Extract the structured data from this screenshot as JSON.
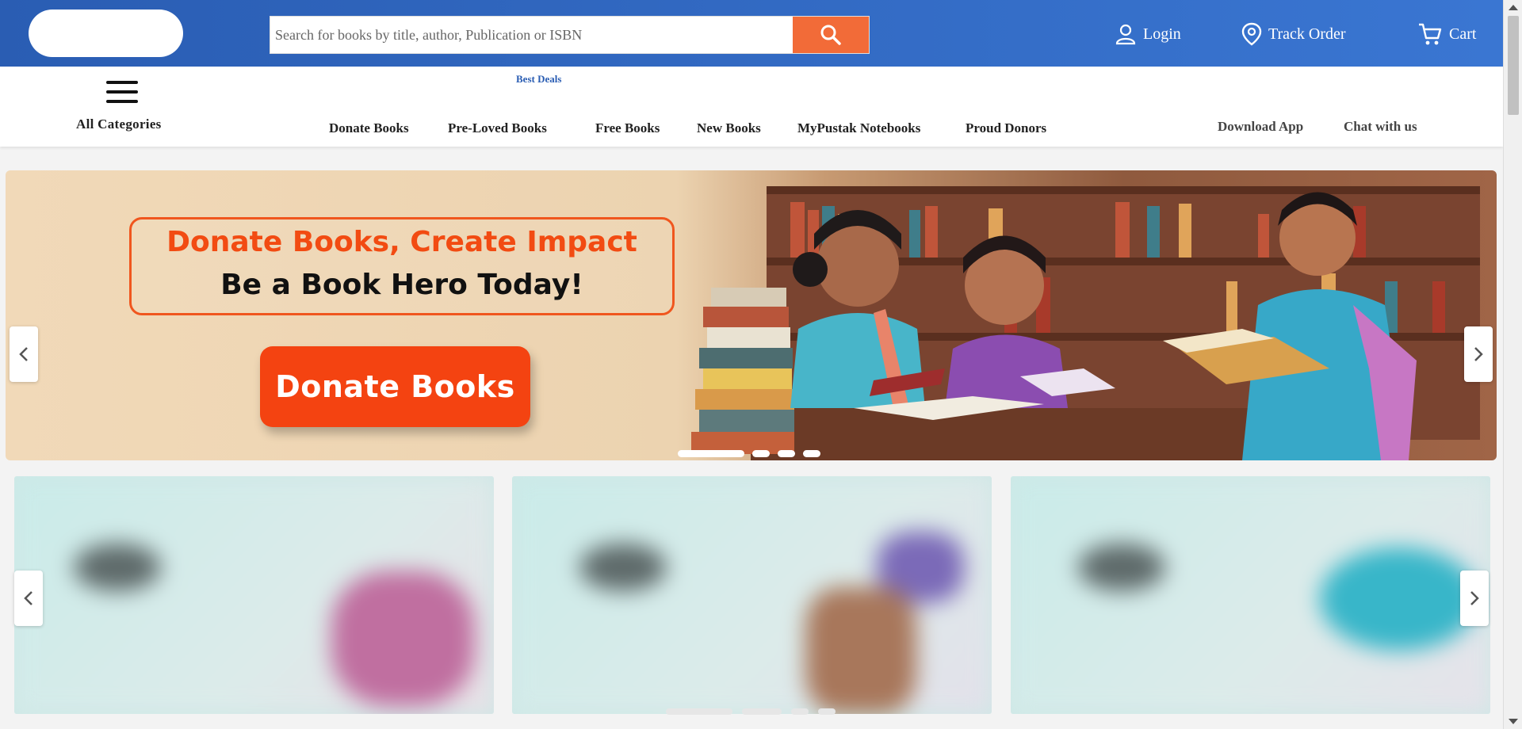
{
  "header": {
    "search": {
      "placeholder": "Search for books by title, author, Publication or ISBN",
      "icon": "search-icon"
    },
    "links": [
      {
        "label": "Login",
        "icon": "user-icon"
      },
      {
        "label": "Track Order",
        "icon": "location-pin-icon"
      },
      {
        "label": "Cart",
        "icon": "cart-icon"
      }
    ],
    "colors": {
      "bar": "#2f67c2",
      "search_button": "#f26b38"
    }
  },
  "nav": {
    "all_categories": "All Categories",
    "best_deals": "Best Deals",
    "items": [
      "Donate Books",
      "Pre-Loved Books",
      "Free Books",
      "New Books",
      "MyPustak Notebooks",
      "Proud Donors"
    ],
    "right": [
      "Download App",
      "Chat with us"
    ]
  },
  "hero": {
    "headline": "Donate Books, Create Impact",
    "subhead": "Be a Book Hero Today!",
    "cta": "Donate Books",
    "colors": {
      "headline": "#f24b12",
      "cta": "#f44311"
    },
    "slides_count": 4,
    "active_slide": 1
  },
  "promo_cards": {
    "count": 3,
    "dots_count": 4
  }
}
